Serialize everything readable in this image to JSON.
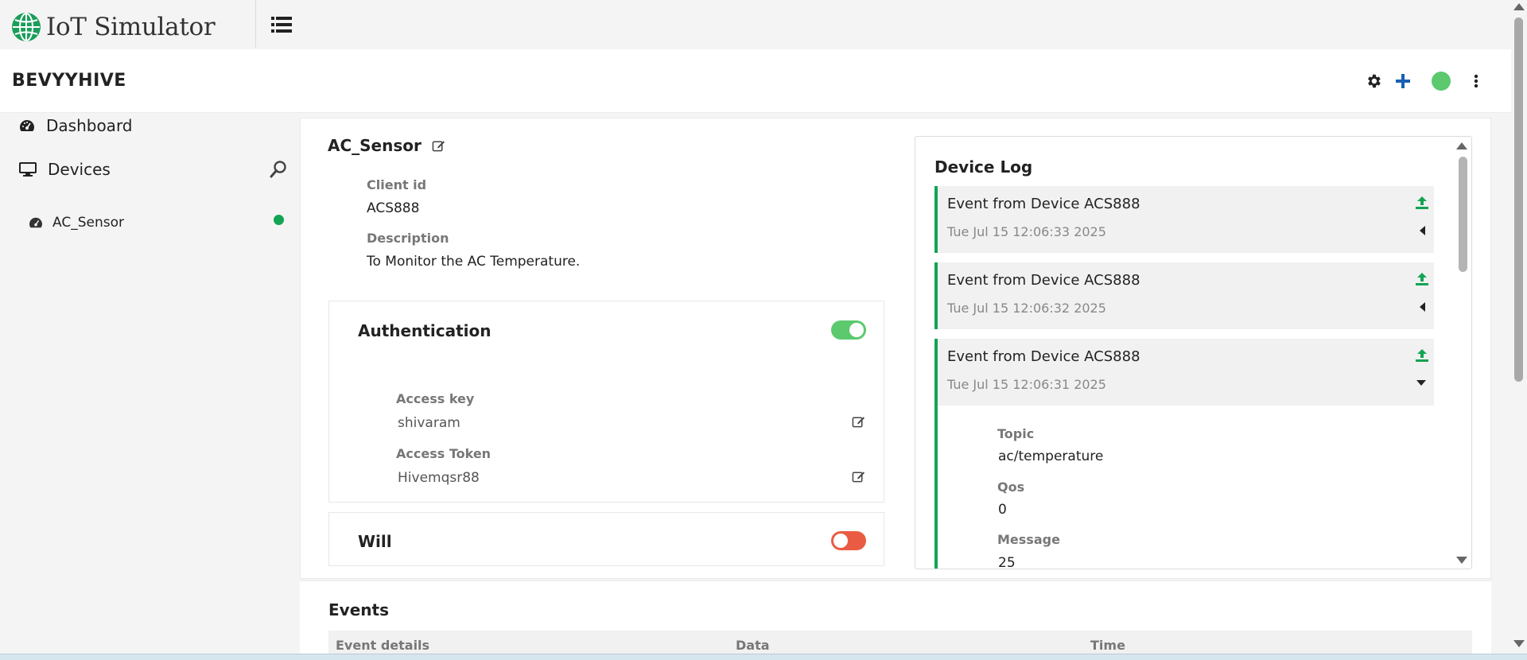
{
  "app": {
    "title": "IoT Simulator"
  },
  "header": {
    "project_name": "BEVYYHIVE",
    "status_color": "#5cc96f"
  },
  "sidebar": {
    "items": [
      {
        "label": "Dashboard",
        "icon": "dashboard-icon"
      },
      {
        "label": "Devices",
        "icon": "monitor-icon"
      }
    ],
    "devices": [
      {
        "label": "AC_Sensor",
        "icon": "dashboard-icon",
        "status": "online"
      }
    ]
  },
  "device": {
    "name": "AC_Sensor",
    "client_id_label": "Client id",
    "client_id": "ACS888",
    "description_label": "Description",
    "description": "To Monitor the AC Temperature."
  },
  "authentication": {
    "title": "Authentication",
    "enabled": true,
    "access_key_label": "Access key",
    "access_key": "shivaram",
    "access_token_label": "Access Token",
    "access_token": "Hivemqsr88"
  },
  "will": {
    "title": "Will",
    "enabled": false
  },
  "device_log": {
    "title": "Device Log",
    "entries": [
      {
        "title": "Event from Device ACS888",
        "time": "Tue Jul 15 12:06:33 2025",
        "expanded": false
      },
      {
        "title": "Event from Device ACS888",
        "time": "Tue Jul 15 12:06:32 2025",
        "expanded": false
      },
      {
        "title": "Event from Device ACS888",
        "time": "Tue Jul 15 12:06:31 2025",
        "expanded": true
      }
    ],
    "detail": {
      "topic_label": "Topic",
      "topic": "ac/temperature",
      "qos_label": "Qos",
      "qos": "0",
      "message_label": "Message",
      "message": "25"
    }
  },
  "events": {
    "title": "Events",
    "columns": [
      "Event details",
      "Data",
      "Time"
    ]
  },
  "colors": {
    "accent_green": "#13a453",
    "toggle_on": "#5cc96f",
    "toggle_off": "#ea5b43",
    "plus_blue": "#1a5fb4"
  }
}
